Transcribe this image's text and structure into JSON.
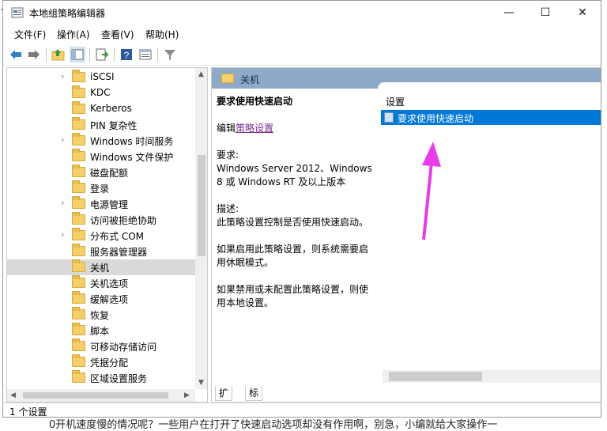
{
  "window": {
    "title": "本地组策略编辑器",
    "minimize": "—",
    "maximize": "☐",
    "close": "✕"
  },
  "menu": [
    "文件(F)",
    "操作(A)",
    "查看(V)",
    "帮助(H)"
  ],
  "toolbar_icons": [
    "back-icon",
    "forward-icon",
    "up-folder-icon",
    "show-hide-tree-icon",
    "export-list-icon",
    "help-icon",
    "properties-icon",
    "filter-icon"
  ],
  "tree": {
    "items": [
      {
        "label": "iSCSI",
        "expandable": true
      },
      {
        "label": "KDC",
        "expandable": false
      },
      {
        "label": "Kerberos",
        "expandable": false
      },
      {
        "label": "PIN 复杂性",
        "expandable": false
      },
      {
        "label": "Windows 时间服务",
        "expandable": true
      },
      {
        "label": "Windows 文件保护",
        "expandable": false
      },
      {
        "label": "磁盘配额",
        "expandable": false
      },
      {
        "label": "登录",
        "expandable": false
      },
      {
        "label": "电源管理",
        "expandable": true
      },
      {
        "label": "访问被拒绝协助",
        "expandable": false
      },
      {
        "label": "分布式 COM",
        "expandable": true
      },
      {
        "label": "服务器管理器",
        "expandable": false
      },
      {
        "label": "关机",
        "expandable": false,
        "selected": true
      },
      {
        "label": "关机选项",
        "expandable": false
      },
      {
        "label": "缓解选项",
        "expandable": false
      },
      {
        "label": "恢复",
        "expandable": false
      },
      {
        "label": "脚本",
        "expandable": false
      },
      {
        "label": "可移动存储访问",
        "expandable": false
      },
      {
        "label": "凭据分配",
        "expandable": false
      },
      {
        "label": "区域设置服务",
        "expandable": false
      }
    ]
  },
  "right": {
    "header": "关机",
    "policy_title": "要求使用快速启动",
    "edit_prefix": "编辑",
    "edit_link": "策略设置",
    "requirement_label": "要求:",
    "requirement_text": "Windows Server 2012、Windows 8 或 Windows RT 及以上版本",
    "description_label": "描述:",
    "description_text": "此策略设置控制是否使用快速启动。",
    "enabled_text": "如果启用此策略设置，则系统需要启用休眠模式。",
    "disabled_text": "如果禁用或未配置此策略设置，则使用本地设置。",
    "list_header": "设置",
    "selected_setting": "要求使用快速启动"
  },
  "tabs": [
    "扩展",
    "标准"
  ],
  "status": "1 个设置",
  "background_text": {
    "bottom_line": "0开机速度慢的情况呢？一些用户在打开了快速启动选项却没有作用啊，别急，小编就给大家操作一",
    "top_left": "+"
  },
  "colors": {
    "selection": "#0078d7",
    "header_bar": "#8fa9c8",
    "annotation_arrow": "#e83ce8"
  }
}
